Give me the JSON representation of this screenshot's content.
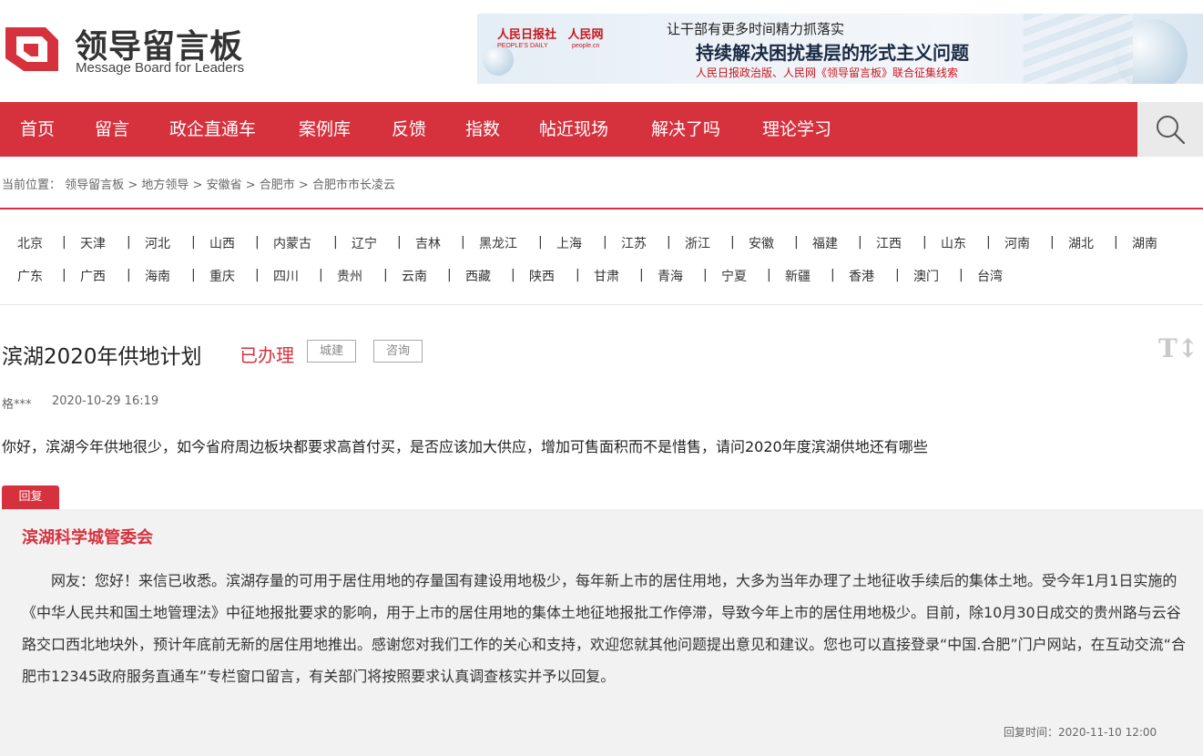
{
  "logo": {
    "cn": "领导留言板",
    "en": "Message Board for Leaders"
  },
  "banner": {
    "logo1": "人民日报社",
    "logo1_sub": "PEOPLE'S DAILY",
    "logo2": "人民网",
    "logo2_sub": "people.cn",
    "line1": "让干部有更多时间精力抓落实",
    "line2": "持续解决困扰基层的形式主义问题",
    "line3": "人民日报政治版、人民网《领导留言板》联合征集线索"
  },
  "nav": {
    "items": [
      "首页",
      "留言",
      "政企直通车",
      "案例库",
      "反馈",
      "指数",
      "帖近现场",
      "解决了吗",
      "理论学习"
    ]
  },
  "breadcrumb": {
    "prefix": "当前位置：",
    "items": [
      "领导留言板",
      "地方领导",
      "安徽省",
      "合肥市",
      "合肥市市长凌云"
    ],
    "separator": ">"
  },
  "provinces": {
    "row1": [
      "北京",
      "天津",
      "河北",
      "山西",
      "内蒙古",
      "辽宁",
      "吉林",
      "黑龙江",
      "上海",
      "江苏",
      "浙江",
      "安徽",
      "福建",
      "江西",
      "山东",
      "河南",
      "湖北",
      "湖南"
    ],
    "row2": [
      "广东",
      "广西",
      "海南",
      "重庆",
      "四川",
      "贵州",
      "云南",
      "西藏",
      "陕西",
      "甘肃",
      "青海",
      "宁夏",
      "新疆",
      "香港",
      "澳门",
      "台湾"
    ]
  },
  "message": {
    "title": "滨湖2020年供地计划",
    "status": "已办理",
    "tags": [
      "城建",
      "咨询"
    ],
    "author": "格***",
    "time": "2020-10-29 16:19",
    "content": "你好，滨湖今年供地很少，如今省府周边板块都要求高首付买，是否应该加大供应，增加可售面积而不是惜售，请问2020年度滨湖供地还有哪些"
  },
  "reply": {
    "tab": "回复",
    "org": "滨湖科学城管委会",
    "text": "网友：您好！来信已收悉。滨湖存量的可用于居住用地的存量国有建设用地极少，每年新上市的居住用地，大多为当年办理了土地征收手续后的集体土地。受今年1月1日实施的《中华人民共和国土地管理法》中征地报批要求的影响，用于上市的居住用地的集体土地征地报批工作停滞，导致今年上市的居住用地极少。目前，除10月30日成交的贵州路与云谷路交口西北地块外，预计年底前无新的居住用地推出。感谢您对我们工作的关心和支持，欢迎您就其他问题提出意见和建议。您也可以直接登录“中国.合肥”门户网站，在互动交流“合肥市12345政府服务直通车”专栏窗口留言，有关部门将按照要求认真调查核实并予以回复。",
    "time_label": "回复时间：",
    "time": "2020-11-10 12:00"
  },
  "icons": {
    "search": "search-icon",
    "font_size": "font-size-icon",
    "logo": "logo-mark-icon"
  },
  "colors": {
    "accent": "#d6323e",
    "nav_bg": "#d6323e",
    "reply_bg": "#f2f2f2"
  }
}
